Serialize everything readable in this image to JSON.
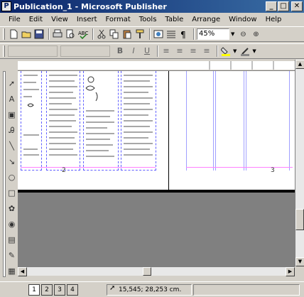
{
  "window": {
    "title": "Publication_1 - Microsoft Publisher",
    "app_icon_letter": "P",
    "minimize": "_",
    "maximize": "□",
    "close": "✕"
  },
  "menu": [
    "File",
    "Edit",
    "View",
    "Insert",
    "Format",
    "Tools",
    "Table",
    "Arrange",
    "Window",
    "Help"
  ],
  "standard_toolbar": {
    "icons": [
      "new-icon",
      "open-icon",
      "save-icon",
      "print-icon",
      "print-preview-icon",
      "spelling-icon",
      "cut-icon",
      "copy-icon",
      "paste-icon",
      "format-painter-icon",
      "web-icon",
      "columns-icon",
      "pilcrow-icon"
    ],
    "zoom_value": "45%",
    "zoom_out": "⊖",
    "zoom_in": "⊕"
  },
  "format_toolbar": {
    "bold": "B",
    "italic": "I",
    "underline": "U",
    "align_left": "≡",
    "align_center": "≡",
    "align_right": "≡",
    "justify": "≡"
  },
  "pages": {
    "left_page_number": "2",
    "right_page_number": "3"
  },
  "statusbar": {
    "page_tabs": [
      "1",
      "2",
      "3",
      "4"
    ],
    "active_page_tab": "1",
    "position": "15,545; 28,253 cm."
  },
  "colors": {
    "title_start": "#0a246a",
    "title_end": "#3a6ea5",
    "chrome": "#d4d0c8",
    "workspace": "#808080",
    "guides": "#6060ff"
  }
}
